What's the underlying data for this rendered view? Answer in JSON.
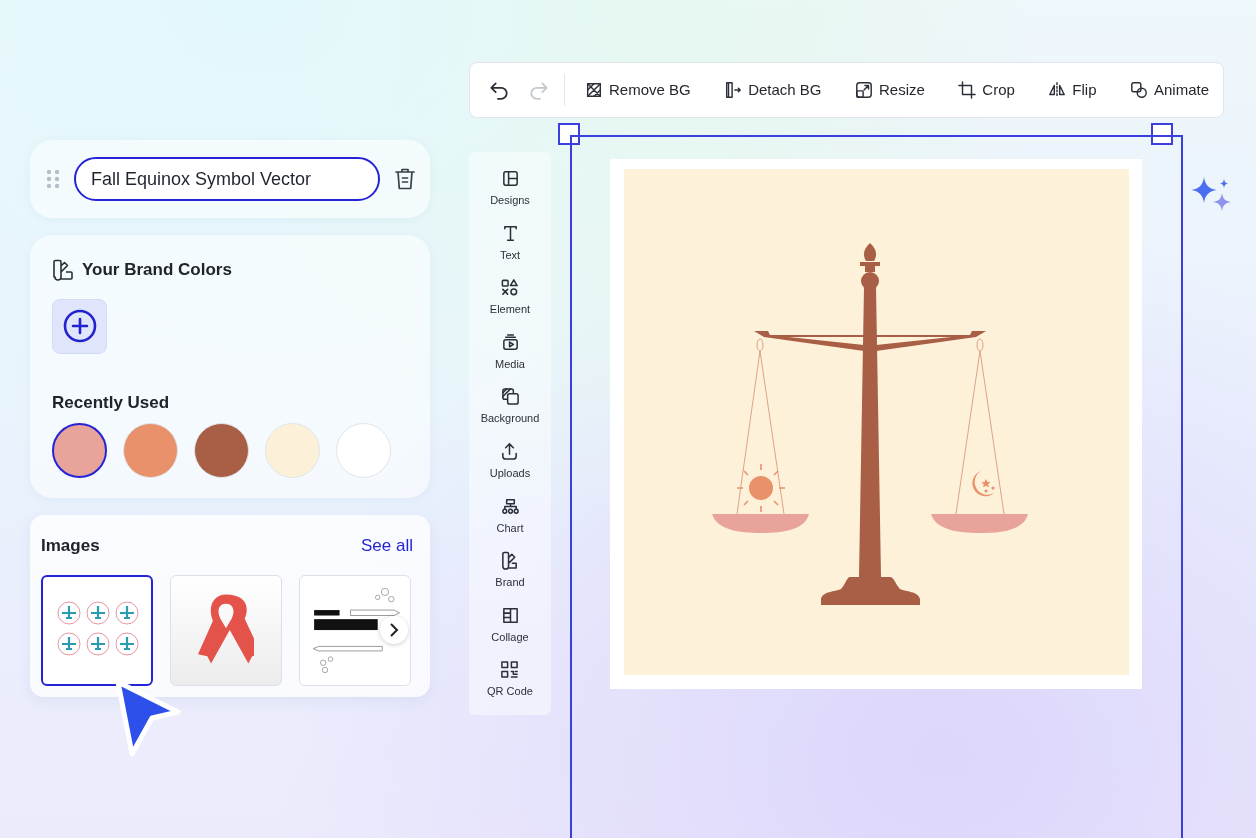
{
  "toolbar": {
    "history": [
      {
        "kind": "undo",
        "disabled": false
      },
      {
        "kind": "redo",
        "disabled": true
      }
    ],
    "tools": [
      {
        "kind": "remove-bg",
        "label": "Remove BG"
      },
      {
        "kind": "detach-bg",
        "label": "Detach BG"
      },
      {
        "kind": "resize",
        "label": "Resize"
      },
      {
        "kind": "crop",
        "label": "Crop"
      },
      {
        "kind": "flip",
        "label": "Flip"
      },
      {
        "kind": "animate",
        "label": "Animate"
      }
    ]
  },
  "layer": {
    "value": "Fall Equinox Symbol Vector"
  },
  "brand_colors": {
    "title": "Your Brand Colors",
    "recent_title": "Recently Used",
    "recent": [
      {
        "color": "#e8a49a",
        "selected": true
      },
      {
        "color": "#e8916a",
        "selected": false
      },
      {
        "color": "#a95e46",
        "selected": false
      },
      {
        "color": "#fdf0d8",
        "selected": false
      },
      {
        "color": "#ffffff",
        "selected": false
      }
    ]
  },
  "images": {
    "title": "Images",
    "link": "See all",
    "items": [
      {
        "kind": "airplane-icons",
        "selected": true
      },
      {
        "kind": "ribbon",
        "selected": false
      },
      {
        "kind": "pencil-card",
        "selected": false
      }
    ]
  },
  "sidebar": {
    "items": [
      {
        "kind": "designs",
        "label": "Designs"
      },
      {
        "kind": "text",
        "label": "Text"
      },
      {
        "kind": "element",
        "label": "Element"
      },
      {
        "kind": "media",
        "label": "Media"
      },
      {
        "kind": "background",
        "label": "Background"
      },
      {
        "kind": "uploads",
        "label": "Uploads"
      },
      {
        "kind": "chart",
        "label": "Chart"
      },
      {
        "kind": "brand",
        "label": "Brand"
      },
      {
        "kind": "collage",
        "label": "Collage"
      },
      {
        "kind": "qr",
        "label": "QR Code"
      }
    ]
  }
}
